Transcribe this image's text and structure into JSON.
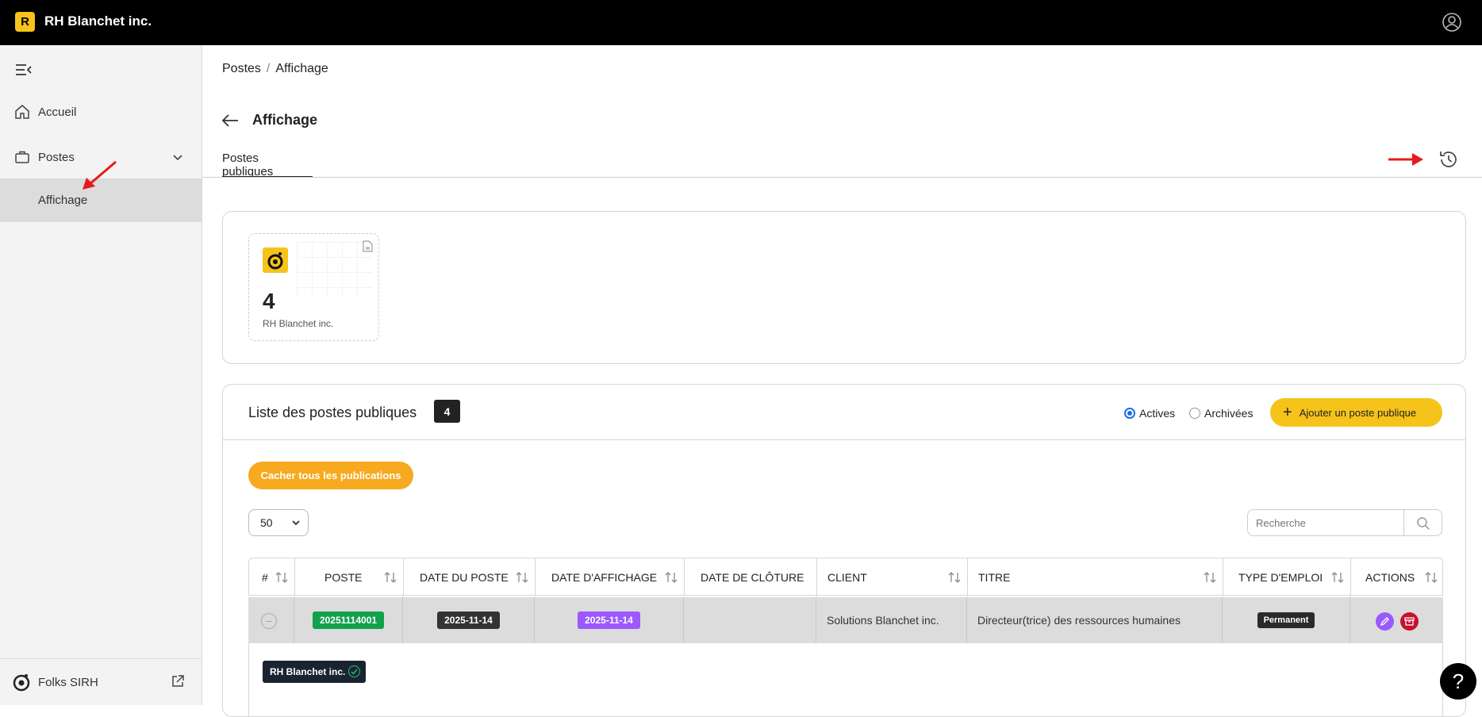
{
  "header": {
    "brand_badge": "R",
    "brand_name": "RH Blanchet inc.",
    "user_icon": "user-circle-icon"
  },
  "sidebar": {
    "items": [
      {
        "label": "Accueil",
        "icon": "home-icon"
      },
      {
        "label": "Postes",
        "icon": "briefcase-icon"
      },
      {
        "label": "Affichage",
        "icon": ""
      }
    ],
    "footer_label": "Folks SIRH"
  },
  "breadcrumb": {
    "root": "Postes",
    "separator": "/",
    "current": "Affichage"
  },
  "page": {
    "title": "Affichage",
    "tab_active": "Postes publiques"
  },
  "stats": {
    "count": "4",
    "label": "RH Blanchet inc."
  },
  "list": {
    "title": "Liste des postes publiques",
    "count": "4",
    "radio_active": "Actives",
    "radio_archived": "Archivées",
    "add_button": "Ajouter un poste publique",
    "hide_button": "Cacher tous les publications",
    "per_page": "50",
    "search_placeholder": "Recherche"
  },
  "table": {
    "headers": [
      "#",
      "POSTE",
      "DATE DU POSTE",
      "DATE D'AFFICHAGE",
      "DATE DE CLÔTURE",
      "CLIENT",
      "TITRE",
      "TYPE D'EMPLOI",
      "ACTIONS"
    ],
    "rows": [
      {
        "poste": "20251114001",
        "date_poste": "2025-11-14",
        "date_affichage": "2025-11-14",
        "date_cloture": "",
        "client": "Solutions Blanchet inc.",
        "titre": "Directeur(trice) des ressources humaines",
        "type": "Permanent",
        "company_chip": "RH Blanchet inc."
      }
    ]
  },
  "help": "?",
  "colors": {
    "accent": "#f6c31a",
    "orange": "#f7a91f",
    "green": "#12a14b",
    "purple": "#9b59ff",
    "red": "#c8102e",
    "annotation": "#e51b1b"
  }
}
